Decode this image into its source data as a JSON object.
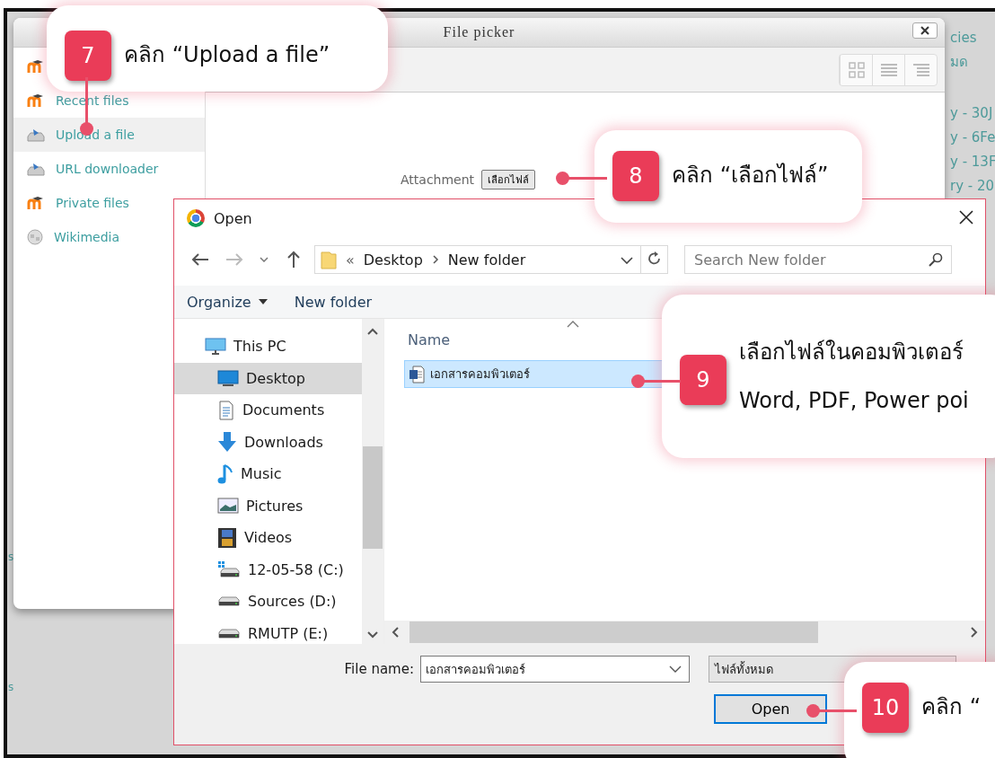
{
  "background_page": {
    "right_fragments": [
      "cies",
      "มด",
      "y - 30J",
      "y - 6Fe",
      "y - 13F",
      "ry - 20"
    ],
    "left_fragments": [
      "s",
      "s"
    ]
  },
  "file_picker": {
    "title": "File picker",
    "sources": [
      {
        "kind": "moodle",
        "selected": false
      },
      {
        "label": "Recent files",
        "kind": "moodle",
        "selected": false
      },
      {
        "label": "Upload a file",
        "kind": "upload",
        "selected": true
      },
      {
        "label": "URL downloader",
        "kind": "upload",
        "selected": false
      },
      {
        "label": "Private files",
        "kind": "moodle",
        "selected": false
      },
      {
        "label": "Wikimedia",
        "kind": "wiki",
        "selected": false
      }
    ],
    "attachment_label": "Attachment",
    "choose_button": "เลือกไฟล์"
  },
  "open_dialog": {
    "title": "Open",
    "breadcrumb_prefix": "«",
    "breadcrumb": [
      "Desktop",
      "New folder"
    ],
    "search_placeholder": "Search New folder",
    "toolbar": [
      {
        "label": "Organize",
        "dropdown": true
      },
      {
        "label": "New folder",
        "dropdown": false
      }
    ],
    "nav_items": [
      {
        "label": "This PC",
        "kind": "pc",
        "selected": false,
        "children": [
          {
            "label": "Desktop",
            "kind": "desktop",
            "selected": true
          },
          {
            "label": "Documents",
            "kind": "documents",
            "selected": false
          },
          {
            "label": "Downloads",
            "kind": "downloads",
            "selected": false
          },
          {
            "label": "Music",
            "kind": "music",
            "selected": false
          },
          {
            "label": "Pictures",
            "kind": "pictures",
            "selected": false
          },
          {
            "label": "Videos",
            "kind": "videos",
            "selected": false
          },
          {
            "label": "12-05-58 (C:)",
            "kind": "system_drive",
            "selected": false
          },
          {
            "label": "Sources (D:)",
            "kind": "drive",
            "selected": false
          },
          {
            "label": "RMUTP (E:)",
            "kind": "drive",
            "selected": false
          }
        ]
      }
    ],
    "column_header": "Name",
    "files": [
      {
        "name": "เอกสารคอมพิวเตอร์",
        "selected": true
      }
    ],
    "file_name_label": "File name:",
    "file_name_value": "เอกสารคอมพิวเตอร์",
    "file_type": "ไฟล์ทั้งหมด",
    "open_button": "Open"
  },
  "callouts": [
    {
      "number": "7",
      "lines": [
        "คลิก “Upload a file”"
      ]
    },
    {
      "number": "8",
      "lines": [
        "คลิก “เลือกไฟล์”"
      ]
    },
    {
      "number": "9",
      "lines": [
        "เลือกไฟล์ในคอมพิวเตอร์",
        "Word, PDF, Power poi"
      ]
    },
    {
      "number": "10",
      "lines": [
        "คลิก “"
      ]
    }
  ]
}
